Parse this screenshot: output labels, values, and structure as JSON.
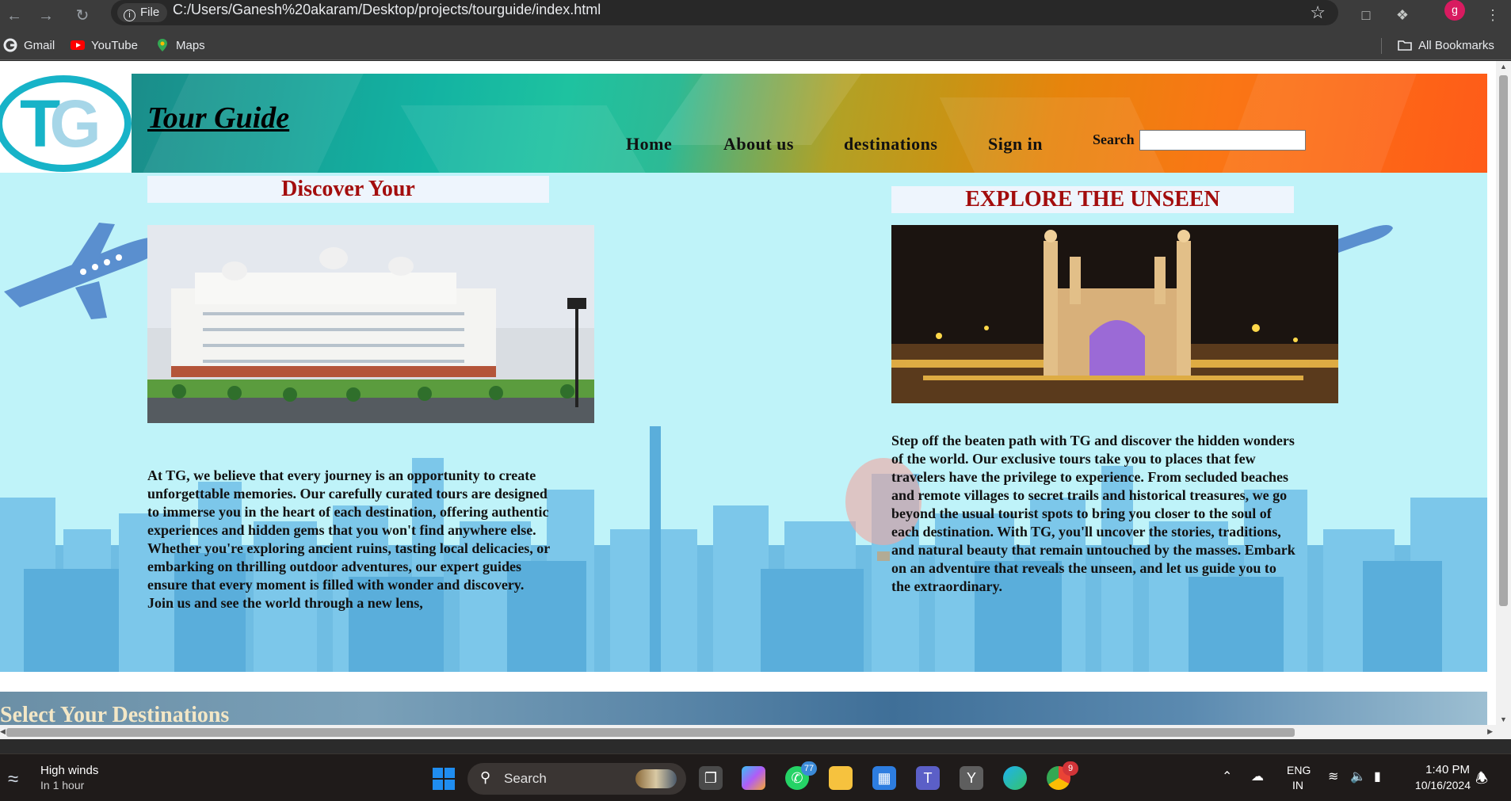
{
  "browser": {
    "chip_label": "File",
    "url": "C:/Users/Ganesh%20akaram/Desktop/projects/tourguide/index.html",
    "profile_initial": "g",
    "bookmarks": [
      {
        "label": "Gmail",
        "icon": "google-icon"
      },
      {
        "label": "YouTube",
        "icon": "youtube-icon"
      },
      {
        "label": "Maps",
        "icon": "maps-icon"
      }
    ],
    "all_bookmarks": "All Bookmarks"
  },
  "site": {
    "logo_text": "TG",
    "title": "Tour Guide",
    "nav": [
      {
        "label": "Home"
      },
      {
        "label": "About us"
      },
      {
        "label": "destinations"
      },
      {
        "label": "Sign in"
      }
    ],
    "search_label": "Search",
    "search_value": ""
  },
  "hero": {
    "left": {
      "heading": "Discover Your",
      "text": "At TG, we believe that every journey is an opportunity to create unforgettable memories. Our carefully curated tours are designed to immerse you in the heart of each destination, offering authentic experiences and hidden gems that you won't find anywhere else. Whether you're exploring ancient ruins, tasting local delicacies, or embarking on thrilling outdoor adventures, our expert guides ensure that every moment is filled with wonder and discovery. Join us and see the world through a new lens,"
    },
    "right": {
      "heading": "EXPLORE THE UNSEEN",
      "text": "Step off the beaten path with TG and discover the hidden wonders of the world. Our exclusive tours take you to places that few travelers have the privilege to experience. From secluded beaches and remote villages to secret trails and historical treasures, we go beyond the usual tourist spots to bring you closer to the soul of each destination. With TG, you'll uncover the stories, traditions, and natural beauty that remain untouched by the masses. Embark on an adventure that reveals the unseen, and let us guide you to the extraordinary."
    }
  },
  "destinations": {
    "title": "Select Your Destinations"
  },
  "taskbar": {
    "weather_title": "High winds",
    "weather_sub": "In 1 hour",
    "search_placeholder": "Search",
    "whatsapp_badge": "77",
    "chrome_badge": "9",
    "lang_line1": "ENG",
    "lang_line2": "IN",
    "time": "1:40 PM",
    "date": "10/16/2024"
  },
  "colors": {
    "accent_heading": "#a30d0d",
    "hero_bg": "#bff3f9",
    "logo": "#17b3c8"
  }
}
